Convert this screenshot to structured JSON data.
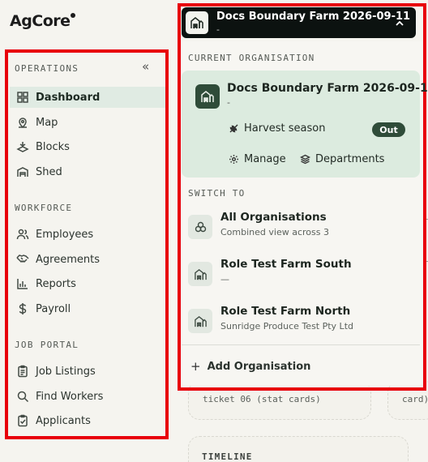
{
  "app": {
    "logo_text": "AgCore"
  },
  "sidebar": {
    "operations_label": "OPERATIONS",
    "collapse_glyph": "«",
    "operations": [
      {
        "label": "Dashboard",
        "icon": "dashboard-icon",
        "active": true
      },
      {
        "label": "Map",
        "icon": "map-pin-icon"
      },
      {
        "label": "Blocks",
        "icon": "blocks-icon"
      },
      {
        "label": "Shed",
        "icon": "shed-icon"
      }
    ],
    "workforce_label": "WORKFORCE",
    "workforce": [
      {
        "label": "Employees",
        "icon": "users-icon"
      },
      {
        "label": "Agreements",
        "icon": "handshake-icon"
      },
      {
        "label": "Reports",
        "icon": "bar-chart-icon"
      },
      {
        "label": "Payroll",
        "icon": "dollar-icon"
      }
    ],
    "job_portal_label": "JOB PORTAL",
    "job_portal": [
      {
        "label": "Job Listings",
        "icon": "clipboard-icon"
      },
      {
        "label": "Find Workers",
        "icon": "search-icon"
      },
      {
        "label": "Applicants",
        "icon": "clipboard-check-icon"
      }
    ]
  },
  "org_switcher": {
    "current_name": "Docs Boundary Farm 2026-09-11",
    "current_sub": "-",
    "current_label": "CURRENT ORGANISATION",
    "season_label": "Harvest season",
    "season_status": "Out",
    "manage_label": "Manage",
    "departments_label": "Departments",
    "switch_label": "SWITCH TO",
    "switch_items": [
      {
        "name": "All Organisations",
        "sub": "Combined view across 3",
        "icon": "organisations-icon"
      },
      {
        "name": "Role Test Farm South",
        "sub": "—",
        "icon": "farm-icon"
      },
      {
        "name": "Role Test Farm North",
        "sub": "Sunridge Produce Test Pty Ltd",
        "icon": "farm-icon"
      }
    ],
    "add_label": "Add Organisation"
  },
  "background": {
    "card_text_1": "ticket 06 (stat cards)",
    "card_text_2": "card)",
    "timeline_label": "TIMELINE"
  },
  "colors": {
    "accent": "#2f4c39",
    "active_bg": "#e0ebe3",
    "highlight": "#e8000b"
  }
}
